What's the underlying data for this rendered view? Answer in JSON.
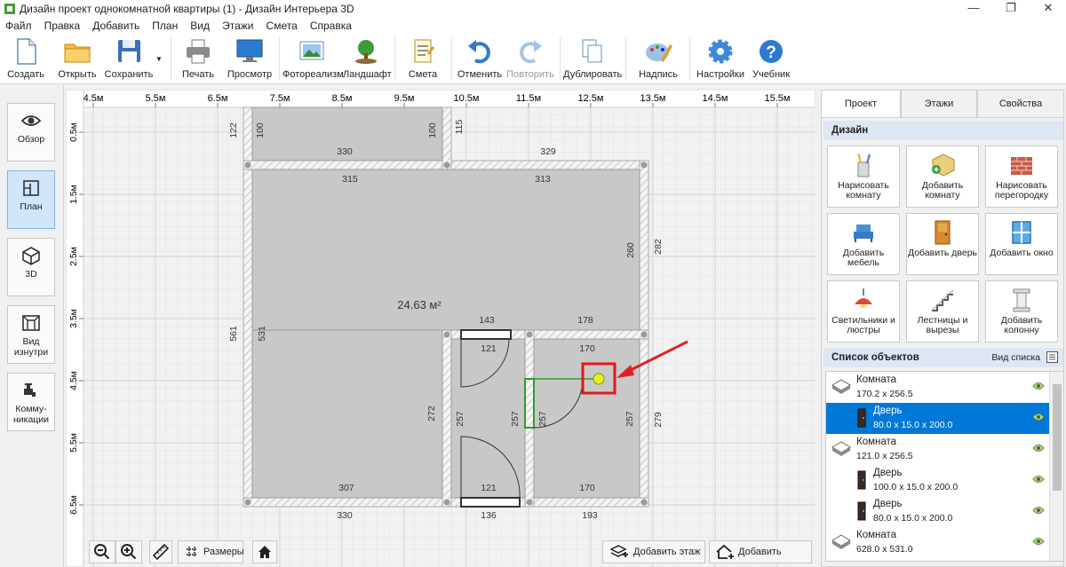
{
  "window": {
    "title": "Дизайн проект однокомнатной квартиры (1) - Дизайн Интерьера 3D"
  },
  "menu": [
    "Файл",
    "Правка",
    "Добавить",
    "План",
    "Вид",
    "Этажи",
    "Смета",
    "Справка"
  ],
  "toolbar": {
    "create": "Создать",
    "open": "Открыть",
    "save": "Сохранить",
    "print": "Печать",
    "preview": "Просмотр",
    "photo": "Фотореализм",
    "landscape": "Ландшафт",
    "estimate": "Смета",
    "undo": "Отменить",
    "redo": "Повторить",
    "duplicate": "Дублировать",
    "text": "Надпись",
    "settings": "Настройки",
    "tutorial": "Учебник"
  },
  "left_nav": {
    "overview": "Обзор",
    "plan": "План",
    "view3d": "3D",
    "inside": "Вид изнутри",
    "comm": "Комму-никации"
  },
  "ruler": {
    "x": [
      "4.5м",
      "5.5м",
      "6.5м",
      "7.5м",
      "8.5м",
      "9.5м",
      "10.5м",
      "11.5м",
      "12.5м",
      "13.5м",
      "14.5м",
      "15.5м"
    ],
    "y": [
      "0.5м",
      "1.5м",
      "2.5м",
      "3.5м",
      "4.5м",
      "5.5м",
      "6.5м"
    ]
  },
  "plan": {
    "area_label": "24.63 м²",
    "dims": [
      "122",
      "100",
      "100",
      "115",
      "330",
      "329",
      "315",
      "313",
      "260",
      "282",
      "561",
      "531",
      "143",
      "178",
      "121",
      "170",
      "272",
      "257",
      "257",
      "257",
      "257",
      "279",
      "307",
      "121",
      "170",
      "330",
      "136",
      "193",
      "307"
    ]
  },
  "bottom": {
    "dims": "Размеры",
    "add_floor": "Добавить этаж",
    "add_roof": "Добавить крышу"
  },
  "right_tabs": [
    "Проект",
    "Этажи",
    "Свойства"
  ],
  "design": {
    "header": "Дизайн",
    "buttons": [
      "Нарисовать комнату",
      "Добавить комнату",
      "Нарисовать перегородку",
      "Добавить мебель",
      "Добавить дверь",
      "Добавить окно",
      "Светильники и люстры",
      "Лестницы и вырезы",
      "Добавить колонну"
    ]
  },
  "objects": {
    "header": "Список объектов",
    "view": "Вид списка",
    "items": [
      {
        "name": "Комната",
        "dims": "170.2 x 256.5"
      },
      {
        "name": "Дверь",
        "dims": "80.0 x 15.0 x 200.0"
      },
      {
        "name": "Комната",
        "dims": "121.0 x 256.5"
      },
      {
        "name": "Дверь",
        "dims": "100.0 x 15.0 x 200.0"
      },
      {
        "name": "Дверь",
        "dims": "80.0 x 15.0 x 200.0"
      },
      {
        "name": "Комната",
        "dims": "628.0 x 531.0"
      }
    ],
    "selected_index": 1
  },
  "colors": {
    "accent": "#0078d7",
    "highlight_box": "#e01818",
    "arrow": "#e02020",
    "door_selected": "#2e9e2e"
  }
}
